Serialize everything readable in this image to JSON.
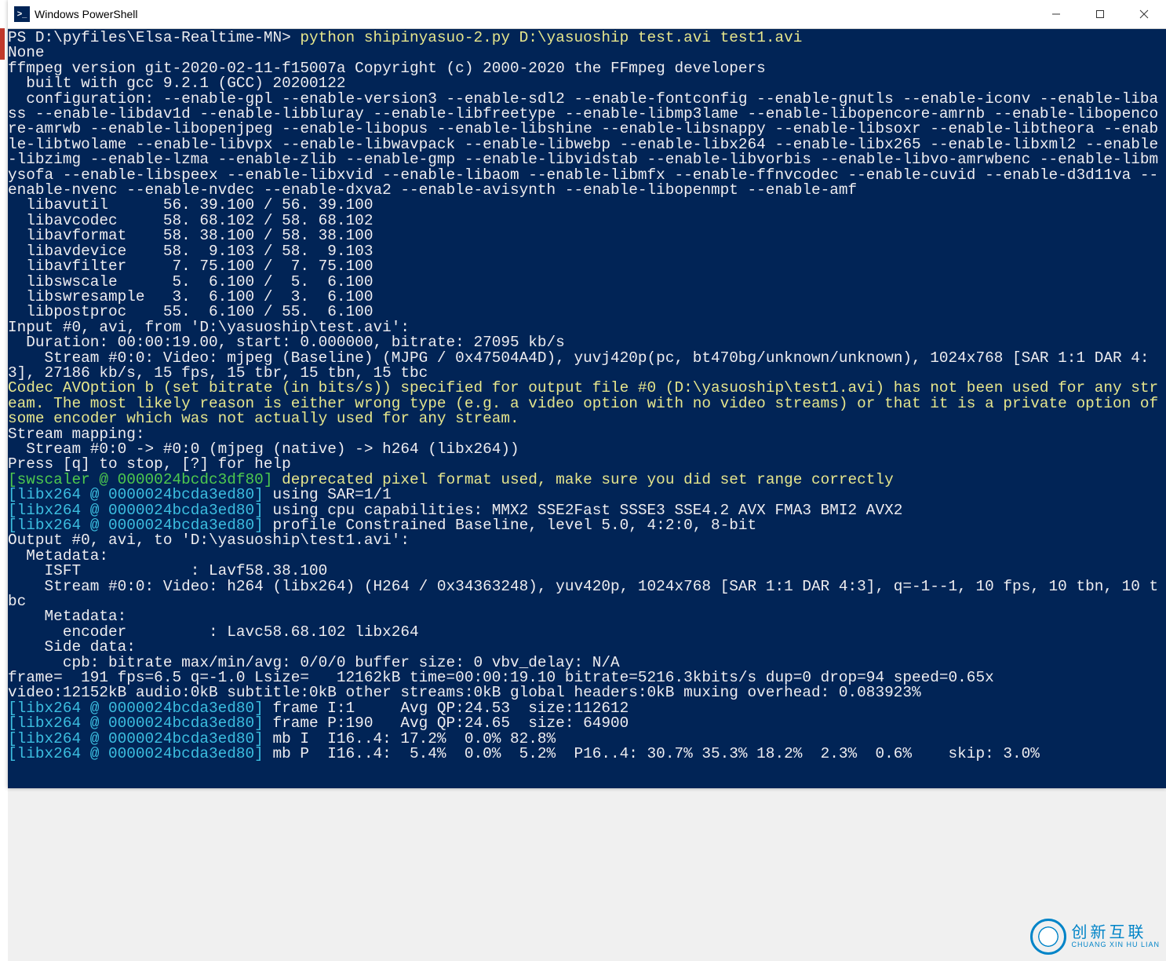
{
  "window": {
    "title": "Windows PowerShell",
    "icon_label": ">_"
  },
  "terminal": {
    "prompt": "PS D:\\pyfiles\\Elsa-Realtime-MN> ",
    "command": "python shipinyasuo-2.py D:\\yasuoship test.avi test1.avi",
    "line_none": "None",
    "ffmpeg_header": "ffmpeg version git-2020-02-11-f15007a Copyright (c) 2000-2020 the FFmpeg developers",
    "built_with": "  built with gcc 9.2.1 (GCC) 20200122",
    "configuration": "  configuration: --enable-gpl --enable-version3 --enable-sdl2 --enable-fontconfig --enable-gnutls --enable-iconv --enable-libass --enable-libdav1d --enable-libbluray --enable-libfreetype --enable-libmp3lame --enable-libopencore-amrnb --enable-libopencore-amrwb --enable-libopenjpeg --enable-libopus --enable-libshine --enable-libsnappy --enable-libsoxr --enable-libtheora --enable-libtwolame --enable-libvpx --enable-libwavpack --enable-libwebp --enable-libx264 --enable-libx265 --enable-libxml2 --enable-libzimg --enable-lzma --enable-zlib --enable-gmp --enable-libvidstab --enable-libvorbis --enable-libvo-amrwbenc --enable-libmysofa --enable-libspeex --enable-libxvid --enable-libaom --enable-libmfx --enable-ffnvcodec --enable-cuvid --enable-d3d11va --enable-nvenc --enable-nvdec --enable-dxva2 --enable-avisynth --enable-libopenmpt --enable-amf",
    "libavutil": "  libavutil      56. 39.100 / 56. 39.100",
    "libavcodec": "  libavcodec     58. 68.102 / 58. 68.102",
    "libavformat": "  libavformat    58. 38.100 / 58. 38.100",
    "libavdevice": "  libavdevice    58.  9.103 / 58.  9.103",
    "libavfilter": "  libavfilter     7. 75.100 /  7. 75.100",
    "libswscale": "  libswscale      5.  6.100 /  5.  6.100",
    "libswresample": "  libswresample   3.  6.100 /  3.  6.100",
    "libpostproc": "  libpostproc    55.  6.100 / 55.  6.100",
    "input0": "Input #0, avi, from 'D:\\yasuoship\\test.avi':",
    "duration": "  Duration: 00:00:19.00, start: 0.000000, bitrate: 27095 kb/s",
    "stream00_in": "    Stream #0:0: Video: mjpeg (Baseline) (MJPG / 0x47504A4D), yuvj420p(pc, bt470bg/unknown/unknown), 1024x768 [SAR 1:1 DAR 4:3], 27186 kb/s, 15 fps, 15 tbr, 15 tbn, 15 tbc",
    "codec_warn": "Codec AVOption b (set bitrate (in bits/s)) specified for output file #0 (D:\\yasuoship\\test1.avi) has not been used for any stream. The most likely reason is either wrong type (e.g. a video option with no video streams) or that it is a private option of some encoder which was not actually used for any stream.",
    "stream_mapping": "Stream mapping:",
    "stream_map_line": "  Stream #0:0 -> #0:0 (mjpeg (native) -> h264 (libx264))",
    "press_q": "Press [q] to stop, [?] for help",
    "swscaler_tag": "[swscaler @ 0000024bcdc3df80] ",
    "swscaler_msg": "deprecated pixel format used, make sure you did set range correctly",
    "libx264_tag": "[libx264 @ 0000024bcda3ed80] ",
    "libx264_sar": "using SAR=1/1",
    "libx264_cpu": "using cpu capabilities: MMX2 SSE2Fast SSSE3 SSE4.2 AVX FMA3 BMI2 AVX2",
    "libx264_profile": "profile Constrained Baseline, level 5.0, 4:2:0, 8-bit",
    "output0": "Output #0, avi, to 'D:\\yasuoship\\test1.avi':",
    "metadata": "  Metadata:",
    "isft": "    ISFT            : Lavf58.38.100",
    "stream00_out": "    Stream #0:0: Video: h264 (libx264) (H264 / 0x34363248), yuv420p, 1024x768 [SAR 1:1 DAR 4:3], q=-1--1, 10 fps, 10 tbn, 10 tbc",
    "metadata2": "    Metadata:",
    "encoder": "      encoder         : Lavc58.68.102 libx264",
    "sidedata": "    Side data:",
    "cpb": "      cpb: bitrate max/min/avg: 0/0/0 buffer size: 0 vbv_delay: N/A",
    "frame_line": "frame=  191 fps=6.5 q=-1.0 Lsize=   12162kB time=00:00:19.10 bitrate=5216.3kbits/s dup=0 drop=94 speed=0.65x",
    "video_line": "video:12152kB audio:0kB subtitle:0kB other streams:0kB global headers:0kB muxing overhead: 0.083923%",
    "frame_i": "frame I:1     Avg QP:24.53  size:112612",
    "frame_p": "frame P:190   Avg QP:24.65  size: 64900",
    "mb_i": "mb I  I16..4: 17.2%  0.0% 82.8%",
    "mb_p": "mb P  I16..4:  5.4%  0.0%  5.2%  P16..4: 30.7% 35.3% 18.2%  2.3%  0.6%    skip: 3.0%"
  },
  "watermark": {
    "cn": "创新互联",
    "en": "CHUANG XIN HU LIAN"
  }
}
